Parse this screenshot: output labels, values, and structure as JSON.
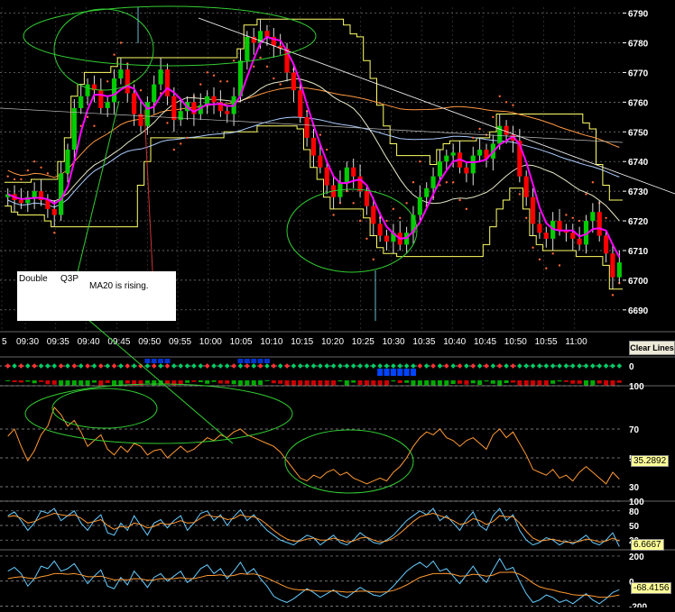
{
  "app": {
    "clear_lines_label": "Clear Lines"
  },
  "colors": {
    "up_candle": "#00cc00",
    "down_candle": "#ff0000",
    "ma_line": "#ff00ff",
    "bollinger": "#ffff66",
    "annotation": "#33cc33",
    "trend_line": "#ffffff",
    "rsi_line": "#ff9933",
    "stoch_k": "#66ccff",
    "stoch_d": "#ff9933"
  },
  "annotations": {
    "note_double": "Double",
    "note_q3p": "Q3P",
    "note_ma20": "MA20 is rising."
  },
  "chart_data": [
    {
      "type": "candlestick",
      "title": "",
      "ylim": [
        6686,
        6792
      ],
      "y_ticks": [
        6690,
        6700,
        6710,
        6720,
        6730,
        6740,
        6750,
        6760,
        6770,
        6780,
        6790
      ],
      "x_tick_labels": [
        "5",
        "09:30",
        "09:35",
        "09:40",
        "09:45",
        "09:50",
        "09:55",
        "10:00",
        "10:05",
        "10:10",
        "10:15",
        "10:20",
        "10:25",
        "10:30",
        "10:35",
        "10:40",
        "10:45",
        "10:50",
        "10:55",
        "11:00"
      ],
      "grid": true,
      "series": [
        {
          "closes": [
            6729,
            6727,
            6726,
            6728,
            6730,
            6727,
            6724,
            6722,
            6736,
            6744,
            6758,
            6762,
            6766,
            6764,
            6758,
            6760,
            6768,
            6771,
            6763,
            6756,
            6752,
            6760,
            6766,
            6771,
            6762,
            6754,
            6757,
            6760,
            6756,
            6759,
            6762,
            6760,
            6757,
            6756,
            6762,
            6774,
            6782,
            6780,
            6784,
            6782,
            6779,
            6778,
            6770,
            6764,
            6755,
            6748,
            6742,
            6738,
            6732,
            6728,
            6733,
            6738,
            6735,
            6730,
            6725,
            6719,
            6715,
            6713,
            6716,
            6712,
            6716,
            6722,
            6728,
            6731,
            6735,
            6740,
            6742,
            6743,
            6738,
            6736,
            6742,
            6744,
            6741,
            6746,
            6752,
            6749,
            6747,
            6735,
            6728,
            6719,
            6716,
            6714,
            6720,
            6717,
            6716,
            6714,
            6712,
            6720,
            6723,
            6715,
            6709,
            6701,
            6706
          ]
        }
      ]
    },
    {
      "type": "line",
      "title": "",
      "ylim": [
        -2,
        2
      ],
      "y_ticks": [
        0
      ],
      "series": []
    },
    {
      "type": "line",
      "title": "",
      "ylim": [
        20,
        100
      ],
      "y_ticks": [
        30,
        50,
        70,
        100
      ],
      "readout": "35.2892",
      "series": [
        {
          "name": "",
          "values": [
            65,
            70,
            58,
            48,
            55,
            66,
            72,
            85,
            80,
            72,
            76,
            68,
            58,
            62,
            66,
            56,
            52,
            58,
            54,
            60,
            58,
            52,
            55,
            56,
            50,
            54,
            58,
            54,
            56,
            60,
            64,
            62,
            66,
            64,
            68,
            70,
            66,
            64,
            62,
            60,
            58,
            54,
            48,
            42,
            36,
            34,
            38,
            36,
            40,
            42,
            38,
            40,
            36,
            34,
            32,
            34,
            36,
            34,
            40,
            44,
            50,
            58,
            64,
            68,
            66,
            70,
            64,
            62,
            58,
            62,
            64,
            60,
            56,
            66,
            70,
            64,
            68,
            60,
            52,
            42,
            40,
            38,
            42,
            36,
            38,
            34,
            40,
            44,
            40,
            36,
            32,
            40,
            35.29
          ]
        }
      ]
    },
    {
      "type": "line",
      "title": "",
      "ylim": [
        0,
        100
      ],
      "y_ticks": [
        20,
        50,
        80,
        100
      ],
      "readout": "6.6667",
      "series": [
        {
          "name": "",
          "values": [
            70,
            78,
            60,
            40,
            55,
            80,
            75,
            85,
            60,
            70,
            80,
            55,
            40,
            60,
            72,
            35,
            30,
            55,
            40,
            70,
            50,
            30,
            55,
            62,
            45,
            60,
            70,
            40,
            55,
            75,
            80,
            60,
            72,
            50,
            68,
            82,
            60,
            72,
            55,
            40,
            30,
            20,
            15,
            10,
            20,
            30,
            25,
            10,
            20,
            30,
            15,
            10,
            20,
            35,
            25,
            15,
            12,
            20,
            30,
            45,
            60,
            70,
            80,
            72,
            85,
            60,
            70,
            55,
            40,
            62,
            78,
            50,
            40,
            70,
            85,
            60,
            72,
            40,
            20,
            10,
            15,
            25,
            20,
            10,
            18,
            12,
            20,
            30,
            15,
            10,
            20,
            35,
            6.67
          ]
        },
        {
          "name": "",
          "values": [
            68,
            70,
            65,
            55,
            58,
            65,
            70,
            75,
            72,
            70,
            72,
            65,
            55,
            58,
            62,
            50,
            42,
            48,
            46,
            55,
            52,
            45,
            48,
            55,
            52,
            55,
            60,
            55,
            56,
            65,
            72,
            68,
            68,
            62,
            64,
            72,
            68,
            68,
            62,
            52,
            40,
            30,
            22,
            18,
            18,
            22,
            24,
            20,
            20,
            24,
            20,
            16,
            18,
            24,
            26,
            20,
            16,
            18,
            24,
            34,
            46,
            58,
            68,
            72,
            75,
            70,
            66,
            60,
            52,
            55,
            64,
            60,
            52,
            58,
            70,
            68,
            68,
            55,
            38,
            24,
            18,
            20,
            22,
            18,
            16,
            15,
            17,
            22,
            20,
            16,
            18,
            24,
            18
          ]
        }
      ]
    },
    {
      "type": "line",
      "title": "",
      "ylim": [
        -210,
        250
      ],
      "y_ticks": [
        -200,
        0,
        200
      ],
      "readout": "-68.4156",
      "series": [
        {
          "name": "",
          "values": [
            80,
            110,
            60,
            -40,
            20,
            120,
            100,
            160,
            80,
            100,
            140,
            60,
            -20,
            40,
            90,
            -40,
            -60,
            30,
            -30,
            80,
            20,
            -50,
            30,
            60,
            0,
            40,
            80,
            -10,
            30,
            100,
            130,
            60,
            100,
            20,
            80,
            150,
            60,
            100,
            20,
            -40,
            -120,
            -150,
            -170,
            -140,
            -100,
            -60,
            -90,
            -130,
            -100,
            -70,
            -110,
            -130,
            -90,
            -50,
            -80,
            -110,
            -120,
            -90,
            -40,
            20,
            80,
            120,
            150,
            110,
            160,
            80,
            100,
            40,
            -20,
            50,
            120,
            40,
            -10,
            90,
            180,
            90,
            110,
            0,
            -100,
            -170,
            -150,
            -110,
            -130,
            -170,
            -150,
            -180,
            -140,
            -100,
            -150,
            -180,
            -140,
            -90,
            -68.42
          ]
        },
        {
          "name": "",
          "values": [
            20,
            30,
            35,
            25,
            20,
            35,
            45,
            60,
            60,
            55,
            60,
            50,
            35,
            35,
            40,
            25,
            10,
            15,
            10,
            20,
            18,
            8,
            10,
            20,
            18,
            20,
            28,
            20,
            20,
            32,
            45,
            45,
            50,
            40,
            45,
            60,
            55,
            58,
            45,
            25,
            0,
            -25,
            -50,
            -65,
            -70,
            -70,
            -75,
            -80,
            -80,
            -78,
            -82,
            -88,
            -85,
            -80,
            -80,
            -85,
            -88,
            -85,
            -75,
            -55,
            -30,
            0,
            30,
            45,
            60,
            60,
            62,
            55,
            40,
            42,
            55,
            50,
            40,
            48,
            70,
            70,
            72,
            55,
            25,
            -15,
            -45,
            -60,
            -70,
            -85,
            -95,
            -108,
            -112,
            -110,
            -118,
            -128,
            -128,
            -120,
            -110
          ]
        }
      ]
    }
  ]
}
